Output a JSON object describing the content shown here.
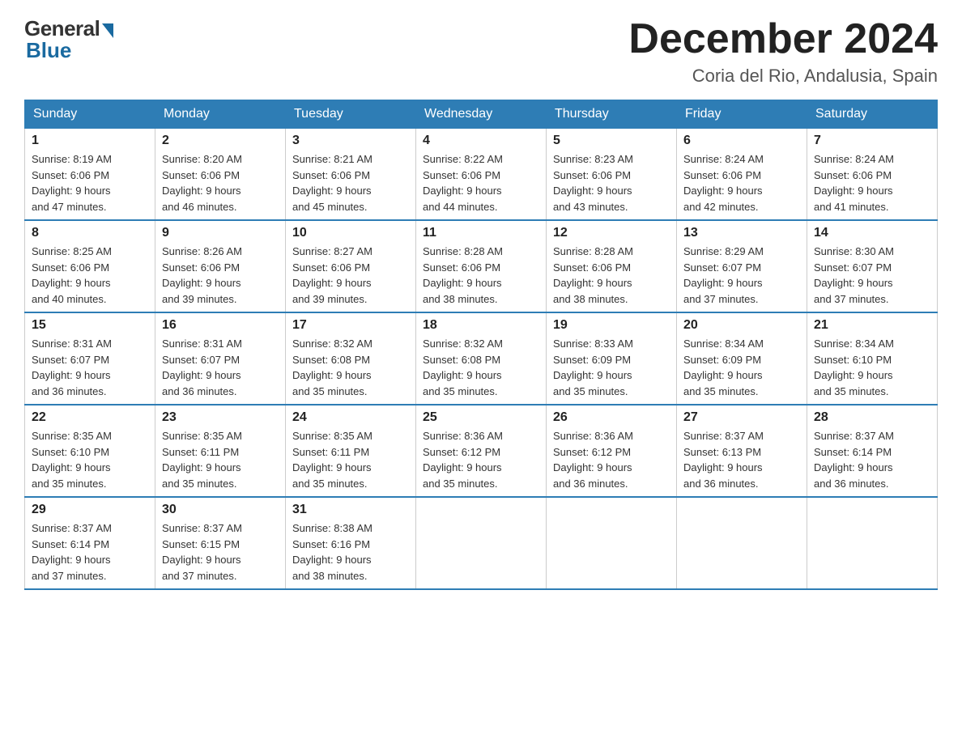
{
  "header": {
    "logo_general": "General",
    "logo_blue": "Blue",
    "month_title": "December 2024",
    "location": "Coria del Rio, Andalusia, Spain"
  },
  "days_of_week": [
    "Sunday",
    "Monday",
    "Tuesday",
    "Wednesday",
    "Thursday",
    "Friday",
    "Saturday"
  ],
  "weeks": [
    [
      {
        "day": "1",
        "sunrise": "8:19 AM",
        "sunset": "6:06 PM",
        "daylight": "9 hours and 47 minutes."
      },
      {
        "day": "2",
        "sunrise": "8:20 AM",
        "sunset": "6:06 PM",
        "daylight": "9 hours and 46 minutes."
      },
      {
        "day": "3",
        "sunrise": "8:21 AM",
        "sunset": "6:06 PM",
        "daylight": "9 hours and 45 minutes."
      },
      {
        "day": "4",
        "sunrise": "8:22 AM",
        "sunset": "6:06 PM",
        "daylight": "9 hours and 44 minutes."
      },
      {
        "day": "5",
        "sunrise": "8:23 AM",
        "sunset": "6:06 PM",
        "daylight": "9 hours and 43 minutes."
      },
      {
        "day": "6",
        "sunrise": "8:24 AM",
        "sunset": "6:06 PM",
        "daylight": "9 hours and 42 minutes."
      },
      {
        "day": "7",
        "sunrise": "8:24 AM",
        "sunset": "6:06 PM",
        "daylight": "9 hours and 41 minutes."
      }
    ],
    [
      {
        "day": "8",
        "sunrise": "8:25 AM",
        "sunset": "6:06 PM",
        "daylight": "9 hours and 40 minutes."
      },
      {
        "day": "9",
        "sunrise": "8:26 AM",
        "sunset": "6:06 PM",
        "daylight": "9 hours and 39 minutes."
      },
      {
        "day": "10",
        "sunrise": "8:27 AM",
        "sunset": "6:06 PM",
        "daylight": "9 hours and 39 minutes."
      },
      {
        "day": "11",
        "sunrise": "8:28 AM",
        "sunset": "6:06 PM",
        "daylight": "9 hours and 38 minutes."
      },
      {
        "day": "12",
        "sunrise": "8:28 AM",
        "sunset": "6:06 PM",
        "daylight": "9 hours and 38 minutes."
      },
      {
        "day": "13",
        "sunrise": "8:29 AM",
        "sunset": "6:07 PM",
        "daylight": "9 hours and 37 minutes."
      },
      {
        "day": "14",
        "sunrise": "8:30 AM",
        "sunset": "6:07 PM",
        "daylight": "9 hours and 37 minutes."
      }
    ],
    [
      {
        "day": "15",
        "sunrise": "8:31 AM",
        "sunset": "6:07 PM",
        "daylight": "9 hours and 36 minutes."
      },
      {
        "day": "16",
        "sunrise": "8:31 AM",
        "sunset": "6:07 PM",
        "daylight": "9 hours and 36 minutes."
      },
      {
        "day": "17",
        "sunrise": "8:32 AM",
        "sunset": "6:08 PM",
        "daylight": "9 hours and 35 minutes."
      },
      {
        "day": "18",
        "sunrise": "8:32 AM",
        "sunset": "6:08 PM",
        "daylight": "9 hours and 35 minutes."
      },
      {
        "day": "19",
        "sunrise": "8:33 AM",
        "sunset": "6:09 PM",
        "daylight": "9 hours and 35 minutes."
      },
      {
        "day": "20",
        "sunrise": "8:34 AM",
        "sunset": "6:09 PM",
        "daylight": "9 hours and 35 minutes."
      },
      {
        "day": "21",
        "sunrise": "8:34 AM",
        "sunset": "6:10 PM",
        "daylight": "9 hours and 35 minutes."
      }
    ],
    [
      {
        "day": "22",
        "sunrise": "8:35 AM",
        "sunset": "6:10 PM",
        "daylight": "9 hours and 35 minutes."
      },
      {
        "day": "23",
        "sunrise": "8:35 AM",
        "sunset": "6:11 PM",
        "daylight": "9 hours and 35 minutes."
      },
      {
        "day": "24",
        "sunrise": "8:35 AM",
        "sunset": "6:11 PM",
        "daylight": "9 hours and 35 minutes."
      },
      {
        "day": "25",
        "sunrise": "8:36 AM",
        "sunset": "6:12 PM",
        "daylight": "9 hours and 35 minutes."
      },
      {
        "day": "26",
        "sunrise": "8:36 AM",
        "sunset": "6:12 PM",
        "daylight": "9 hours and 36 minutes."
      },
      {
        "day": "27",
        "sunrise": "8:37 AM",
        "sunset": "6:13 PM",
        "daylight": "9 hours and 36 minutes."
      },
      {
        "day": "28",
        "sunrise": "8:37 AM",
        "sunset": "6:14 PM",
        "daylight": "9 hours and 36 minutes."
      }
    ],
    [
      {
        "day": "29",
        "sunrise": "8:37 AM",
        "sunset": "6:14 PM",
        "daylight": "9 hours and 37 minutes."
      },
      {
        "day": "30",
        "sunrise": "8:37 AM",
        "sunset": "6:15 PM",
        "daylight": "9 hours and 37 minutes."
      },
      {
        "day": "31",
        "sunrise": "8:38 AM",
        "sunset": "6:16 PM",
        "daylight": "9 hours and 38 minutes."
      },
      null,
      null,
      null,
      null
    ]
  ],
  "labels": {
    "sunrise": "Sunrise:",
    "sunset": "Sunset:",
    "daylight": "Daylight:"
  }
}
